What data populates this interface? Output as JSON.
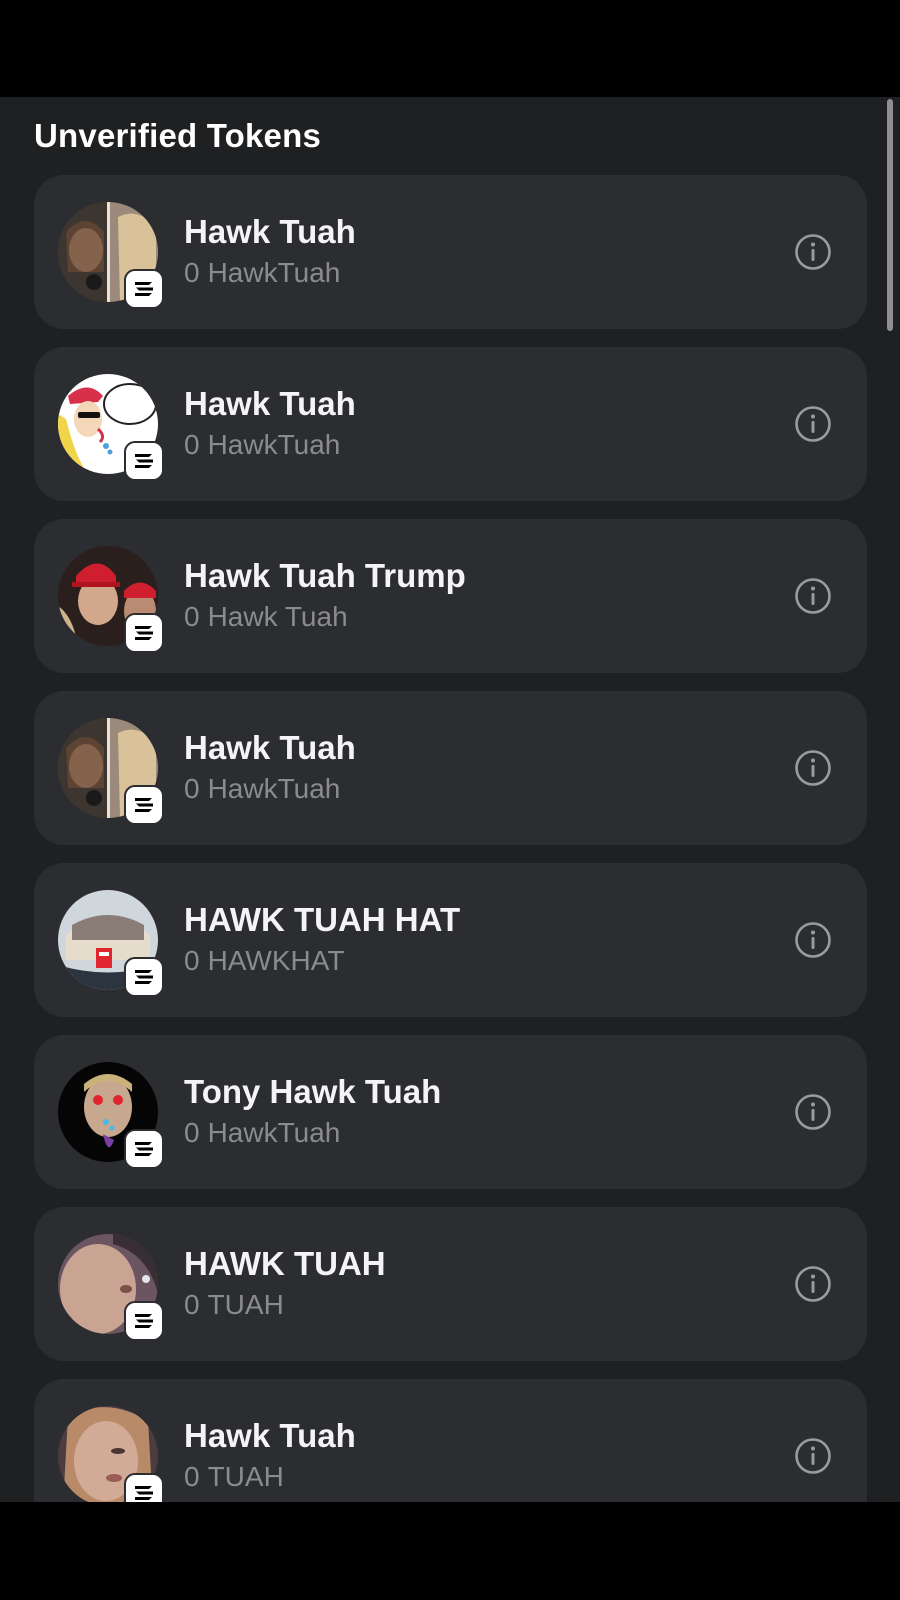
{
  "section": {
    "title": "Unverified Tokens"
  },
  "tokens": [
    {
      "name": "Hawk Tuah",
      "amount": "0",
      "symbol": "HawkTuah"
    },
    {
      "name": "Hawk Tuah",
      "amount": "0",
      "symbol": "HawkTuah"
    },
    {
      "name": "Hawk Tuah Trump",
      "amount": "0",
      "symbol": "Hawk Tuah"
    },
    {
      "name": "Hawk Tuah",
      "amount": "0",
      "symbol": "HawkTuah"
    },
    {
      "name": "HAWK TUAH HAT",
      "amount": "0",
      "symbol": "HAWKHAT"
    },
    {
      "name": "Tony Hawk Tuah",
      "amount": "0",
      "symbol": "HawkTuah"
    },
    {
      "name": "HAWK TUAH",
      "amount": "0",
      "symbol": "TUAH"
    },
    {
      "name": "Hawk Tuah",
      "amount": "0",
      "symbol": "TUAH"
    }
  ],
  "icons": {
    "chain_badge": "solana-icon",
    "info": "info-icon"
  },
  "colors": {
    "background": "#000000",
    "sheet": "#1f2022",
    "card": "#2c2d31",
    "muted_text": "#8a8b90"
  }
}
